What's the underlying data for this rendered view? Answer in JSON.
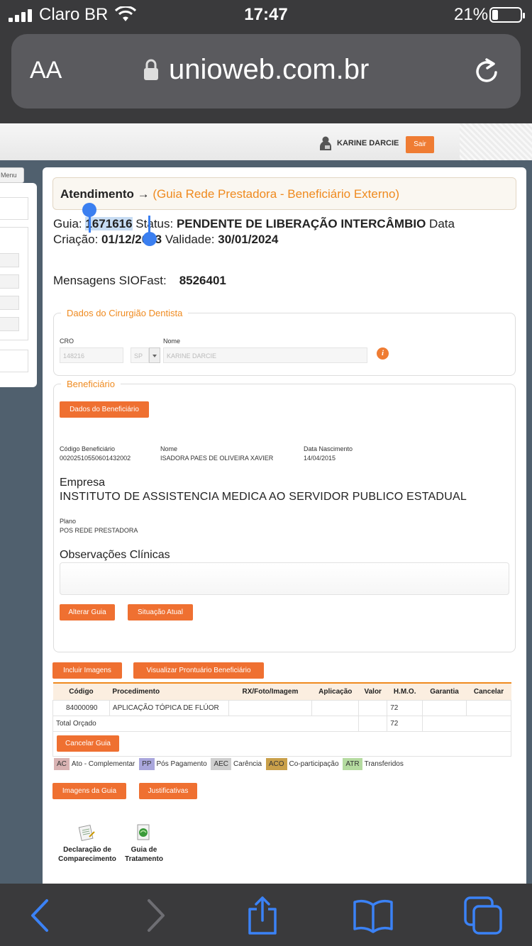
{
  "status_bar": {
    "carrier": "Claro BR",
    "time": "17:47",
    "battery_pct": "21%"
  },
  "browser": {
    "aa_label": "AA",
    "domain": "unioweb.com.br"
  },
  "topbar": {
    "user_name": "KARINE DARCIE",
    "logout_label": "Sair"
  },
  "left_panel": {
    "menu_label": "Menu"
  },
  "header": {
    "title": "Atendimento →",
    "subtitle": "(Guia Rede Prestadora - Beneficiário Externo)"
  },
  "guia": {
    "guia_label": "Guia:",
    "guia_number": "1671616",
    "status_label": "Status:",
    "status_value": "PENDENTE DE LIBERAÇÃO INTERCÂMBIO",
    "data_label": "Data",
    "criacao_label": "Criação:",
    "criacao_value": "01/12/2023",
    "validade_label": "Validade:",
    "validade_value": "30/01/2024"
  },
  "siofast": {
    "label": "Mensagens SIOFast:",
    "value": "8526401"
  },
  "dentista": {
    "legend": "Dados do Cirurgião Dentista",
    "cro_label": "CRO",
    "cro_value": "148216",
    "uf_value": "SP",
    "nome_label": "Nome",
    "nome_value": "KARINE DARCIE"
  },
  "beneficiario": {
    "legend": "Beneficiário",
    "dados_button": "Dados do Beneficiário",
    "codigo_label": "Código Beneficiário",
    "codigo_value": "00202510550601432002",
    "nome_label": "Nome",
    "nome_value": "ISADORA PAES DE OLIVEIRA XAVIER",
    "nascimento_label": "Data Nascimento",
    "nascimento_value": "14/04/2015",
    "empresa_title": "Empresa",
    "empresa_value": "INSTITUTO DE ASSISTENCIA MEDICA AO SERVIDOR PUBLICO ESTADUAL",
    "plano_label": "Plano",
    "plano_value": "POS REDE PRESTADORA",
    "obs_title": "Observações Clínicas",
    "alterar_button": "Alterar Guia",
    "situacao_button": "Situação Atual"
  },
  "actions": {
    "incluir_imagens": "Incluir Imagens",
    "visualizar_prontuario": "Visualizar Prontuário Beneficiário",
    "cancelar_guia": "Cancelar Guia",
    "imagens_guia": "Imagens da Guia",
    "justificativas": "Justificativas"
  },
  "procedures": {
    "headers": [
      "Código",
      "Procedimento",
      "RX/Foto/Imagem",
      "Aplicação",
      "Valor",
      "H.M.O.",
      "Garantia",
      "Cancelar"
    ],
    "rows": [
      {
        "codigo": "84000090",
        "procedimento": "APLICAÇÃO TÓPICA DE FLÚOR",
        "rx": "",
        "aplicacao": "",
        "valor": "",
        "hmo": "72",
        "garantia": "",
        "cancelar": ""
      }
    ],
    "total_label": "Total Orçado",
    "total_hmo": "72"
  },
  "legend": [
    {
      "tag": "AC",
      "label": "Ato - Complementar",
      "color": "#d9b3b3"
    },
    {
      "tag": "PP",
      "label": "Pós Pagamento",
      "color": "#a9a6dc"
    },
    {
      "tag": "AEC",
      "label": "Carência",
      "color": "#cfcfcf"
    },
    {
      "tag": "ACO",
      "label": "Co-participação",
      "color": "#c9a04a"
    },
    {
      "tag": "ATR",
      "label": "Transferidos",
      "color": "#b5dba0"
    }
  ],
  "documents": {
    "declaracao_line1": "Declaração de",
    "declaracao_line2": "Comparecimento",
    "guia_line1": "Guia de",
    "guia_line2": "Tratamento"
  },
  "colors": {
    "accent_orange": "#ef7031",
    "selection_blue": "#3b7ff0"
  }
}
